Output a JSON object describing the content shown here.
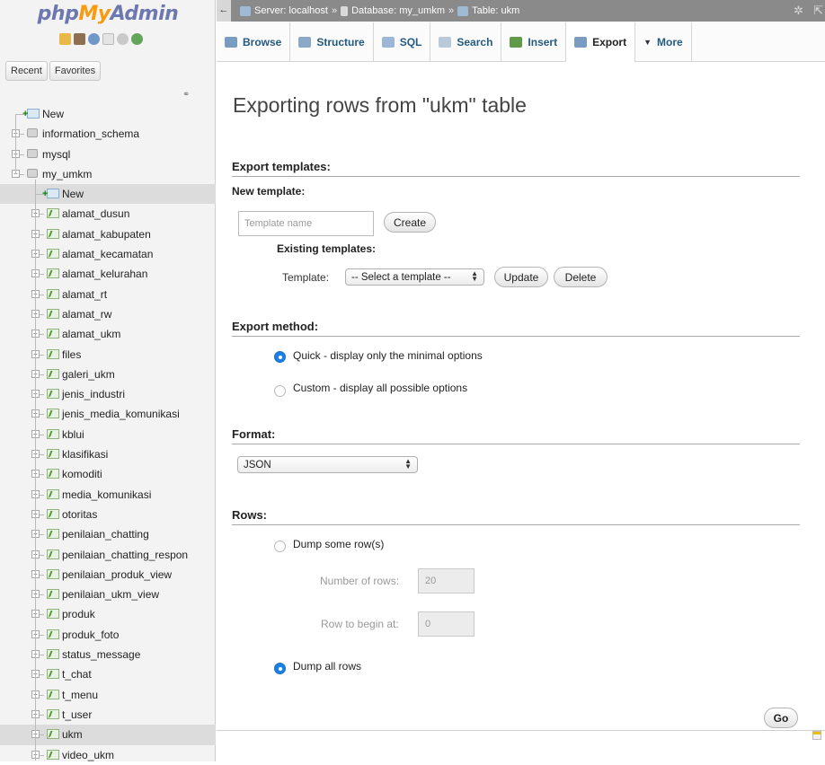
{
  "logo": {
    "part1": "php",
    "part2": "My",
    "part3": "Admin"
  },
  "nav": {
    "recent_label": "Recent",
    "favorites_label": "Favorites",
    "tree": [
      {
        "label": "New",
        "kind": "new",
        "level": 0
      },
      {
        "label": "information_schema",
        "kind": "db",
        "level": 0
      },
      {
        "label": "mysql",
        "kind": "db",
        "level": 0
      },
      {
        "label": "my_umkm",
        "kind": "db",
        "level": 0,
        "expanded": true
      },
      {
        "label": "New",
        "kind": "new",
        "level": 1,
        "selected": true
      },
      {
        "label": "alamat_dusun",
        "kind": "table",
        "level": 1
      },
      {
        "label": "alamat_kabupaten",
        "kind": "table",
        "level": 1
      },
      {
        "label": "alamat_kecamatan",
        "kind": "table",
        "level": 1
      },
      {
        "label": "alamat_kelurahan",
        "kind": "table",
        "level": 1
      },
      {
        "label": "alamat_rt",
        "kind": "table",
        "level": 1
      },
      {
        "label": "alamat_rw",
        "kind": "table",
        "level": 1
      },
      {
        "label": "alamat_ukm",
        "kind": "table",
        "level": 1
      },
      {
        "label": "files",
        "kind": "table",
        "level": 1
      },
      {
        "label": "galeri_ukm",
        "kind": "table",
        "level": 1
      },
      {
        "label": "jenis_industri",
        "kind": "table",
        "level": 1
      },
      {
        "label": "jenis_media_komunikasi",
        "kind": "table",
        "level": 1
      },
      {
        "label": "kblui",
        "kind": "table",
        "level": 1
      },
      {
        "label": "klasifikasi",
        "kind": "table",
        "level": 1
      },
      {
        "label": "komoditi",
        "kind": "table",
        "level": 1
      },
      {
        "label": "media_komunikasi",
        "kind": "table",
        "level": 1
      },
      {
        "label": "otoritas",
        "kind": "table",
        "level": 1
      },
      {
        "label": "penilaian_chatting",
        "kind": "table",
        "level": 1
      },
      {
        "label": "penilaian_chatting_respon",
        "kind": "table",
        "level": 1
      },
      {
        "label": "penilaian_produk_view",
        "kind": "table",
        "level": 1
      },
      {
        "label": "penilaian_ukm_view",
        "kind": "table",
        "level": 1
      },
      {
        "label": "produk",
        "kind": "table",
        "level": 1
      },
      {
        "label": "produk_foto",
        "kind": "table",
        "level": 1
      },
      {
        "label": "status_message",
        "kind": "table",
        "level": 1
      },
      {
        "label": "t_chat",
        "kind": "table",
        "level": 1
      },
      {
        "label": "t_menu",
        "kind": "table",
        "level": 1
      },
      {
        "label": "t_user",
        "kind": "table",
        "level": 1
      },
      {
        "label": "ukm",
        "kind": "table",
        "level": 1,
        "selected": true
      },
      {
        "label": "video_ukm",
        "kind": "table",
        "level": 1
      }
    ]
  },
  "breadcrumb": {
    "server": "Server: localhost",
    "database": "Database: my_umkm",
    "table": "Table: ukm",
    "separator": "»"
  },
  "tabs": [
    {
      "label": "Browse",
      "icon": "browse-icon",
      "color": "#7a9cc0"
    },
    {
      "label": "Structure",
      "icon": "structure-icon",
      "color": "#8aa8c8"
    },
    {
      "label": "SQL",
      "icon": "sql-icon",
      "color": "#9bb6d6"
    },
    {
      "label": "Search",
      "icon": "search-icon",
      "color": "#b9c9d9"
    },
    {
      "label": "Insert",
      "icon": "insert-icon",
      "color": "#5f9a48"
    },
    {
      "label": "Export",
      "icon": "export-icon",
      "color": "#7a9cc0",
      "active": true
    },
    {
      "label": "More",
      "icon": "chevron-down-icon",
      "color": "#333333"
    }
  ],
  "main": {
    "title": "Exporting rows from \"ukm\" table",
    "templates": {
      "heading": "Export templates:",
      "new_template_label": "New template:",
      "template_name_placeholder": "Template name",
      "create_label": "Create",
      "existing_label": "Existing templates:",
      "template_label": "Template:",
      "select_value": "-- Select a template --",
      "update_label": "Update",
      "delete_label": "Delete"
    },
    "method": {
      "heading": "Export method:",
      "quick": "Quick - display only the minimal options",
      "custom": "Custom - display all possible options",
      "selected": "quick"
    },
    "format": {
      "heading": "Format:",
      "value": "JSON"
    },
    "rows": {
      "heading": "Rows:",
      "dump_some": "Dump some row(s)",
      "number_of_rows_label": "Number of rows:",
      "number_of_rows_value": "20",
      "row_begin_label": "Row to begin at:",
      "row_begin_value": "0",
      "dump_all": "Dump all rows",
      "selected": "dump_all"
    },
    "go_label": "Go"
  },
  "colors": {
    "accent": "#1b80e6",
    "topbar": "#8a8a8a",
    "tab_text": "#235a81"
  }
}
